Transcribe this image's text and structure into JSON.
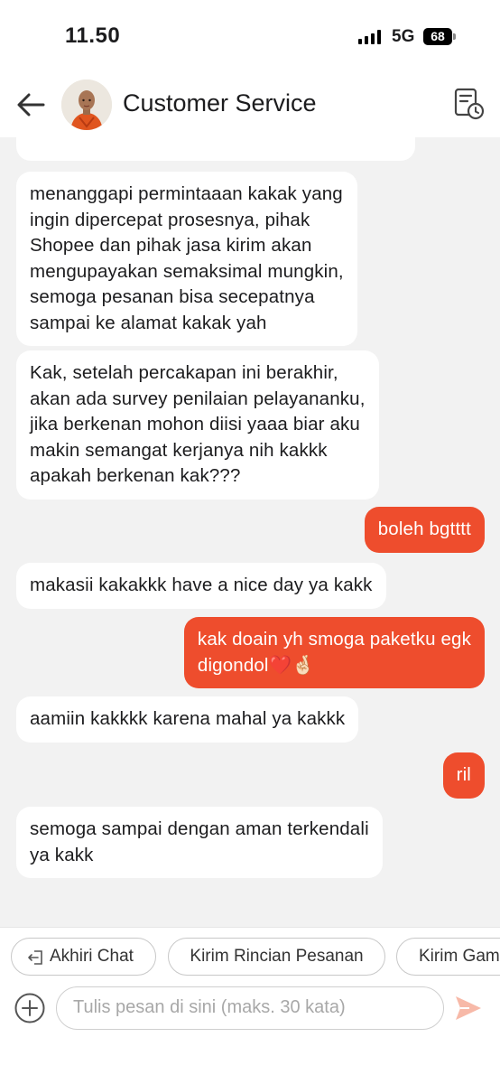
{
  "status_bar": {
    "time": "11.50",
    "network": "5G",
    "battery": "68",
    "icons": [
      "signal-icon",
      "battery-icon"
    ]
  },
  "header": {
    "title": "Customer Service",
    "icons": [
      "back-arrow-icon",
      "avatar",
      "chat-history-icon"
    ]
  },
  "messages": [
    {
      "side": "in",
      "lines": [
        "menanggapi permintaaan kakak yang",
        "ingin dipercepat prosesnya, pihak",
        "Shopee dan pihak jasa kirim akan",
        "mengupayakan semaksimal mungkin,",
        "semoga pesanan bisa secepatnya",
        "sampai ke alamat kakak yah"
      ]
    },
    {
      "side": "in",
      "lines": [
        "Kak, setelah percakapan ini berakhir,",
        "akan ada survey penilaian pelayananku,",
        "jika berkenan mohon diisi yaaa biar aku",
        "makin semangat kerjanya nih kakkk",
        "apakah berkenan kak???"
      ]
    },
    {
      "side": "out",
      "lines": [
        "boleh bgtttt"
      ]
    },
    {
      "side": "in",
      "lines": [
        "makasii kakakkk have a nice day ya kakk"
      ]
    },
    {
      "side": "out",
      "lines": [
        "kak doain yh smoga paketku egk",
        "digondol❤️🤞🏻"
      ]
    },
    {
      "side": "in",
      "lines": [
        "aamiin kakkkk karena mahal ya kakkk"
      ]
    },
    {
      "side": "out",
      "lines": [
        "ril"
      ]
    },
    {
      "side": "in",
      "lines": [
        "semoga sampai dengan aman terkendali",
        "ya kakk"
      ]
    }
  ],
  "quick_replies": [
    {
      "label": "Akhiri Chat",
      "icon": "exit-icon"
    },
    {
      "label": "Kirim Rincian Pesanan"
    },
    {
      "label": "Kirim Gam"
    }
  ],
  "composer": {
    "placeholder": "Tulis pesan di sini (maks. 30 kata)",
    "icons": [
      "plus-circle-icon",
      "send-icon"
    ]
  },
  "colors": {
    "accent": "#ee4d2d",
    "incoming_bubble": "#ffffff",
    "background": "#f2f2f2"
  }
}
